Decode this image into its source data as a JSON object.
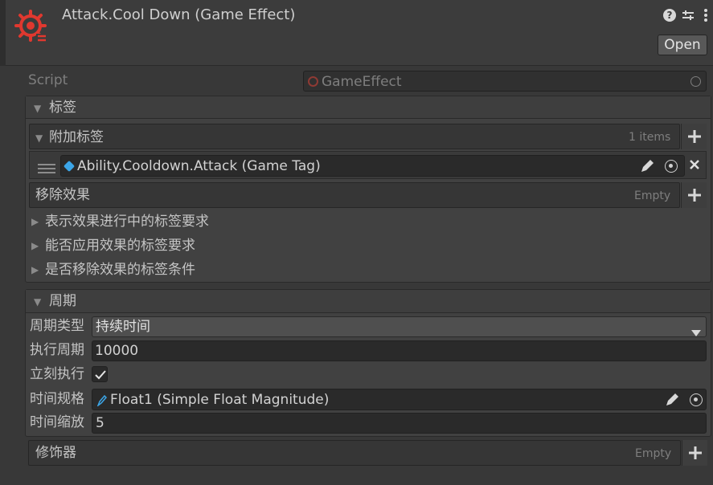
{
  "header": {
    "title": "Attack.Cool Down (Game Effect)",
    "open_label": "Open",
    "help_icon": "question-icon",
    "presets_icon": "sliders-icon",
    "menu_icon": "kebab-icon"
  },
  "script_row": {
    "label": "Script",
    "value": "GameEffect"
  },
  "tags_section": {
    "title": "标签",
    "additional_tags": {
      "title": "附加标签",
      "count_label": "1 items",
      "items": [
        {
          "value": "Ability.Cooldown.Attack (Game Tag)"
        }
      ]
    },
    "remove_effects": {
      "title": "移除效果",
      "empty_label": "Empty"
    },
    "foldouts": [
      "表示效果进行中的标签要求",
      "能否应用效果的标签要求",
      "是否移除效果的标签条件"
    ]
  },
  "period_section": {
    "title": "周期",
    "fields": {
      "period_type_label": "周期类型",
      "period_type_value": "持续时间",
      "exec_period_label": "执行周期",
      "exec_period_value": "10000",
      "exec_immediately_label": "立刻执行",
      "exec_immediately_checked": true,
      "time_spec_label": "时间规格",
      "time_spec_value": "Float1 (Simple Float Magnitude)",
      "time_scale_label": "时间缩放",
      "time_scale_value": "5"
    }
  },
  "modifiers": {
    "title": "修饰器",
    "empty_label": "Empty"
  },
  "colors": {
    "background": "#383838",
    "logo_red": "#e0382f",
    "tag_blue": "#3ca6e8",
    "field_bg": "#2a2a2a"
  }
}
